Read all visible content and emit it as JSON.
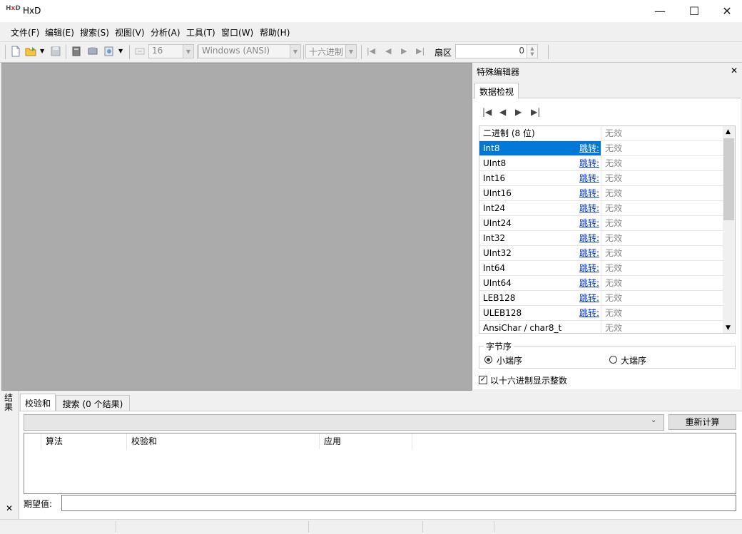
{
  "window": {
    "title": "HxD",
    "icon_text": "HxD"
  },
  "menu": [
    "文件(F)",
    "编辑(E)",
    "搜索(S)",
    "视图(V)",
    "分析(A)",
    "工具(T)",
    "窗口(W)",
    "帮助(H)"
  ],
  "toolbar": {
    "bytes_per_row": "16",
    "encoding": "Windows (ANSI)",
    "offset_base": "十六进制",
    "sector_label": "扇区",
    "sector_value": "0"
  },
  "special_editor": {
    "title": "特殊编辑器",
    "tab": "数据检视",
    "rows": [
      {
        "name": "二进制 (8 位)",
        "jump": "",
        "value": "无效"
      },
      {
        "name": "Int8",
        "jump": "跳转:",
        "value": "无效",
        "selected": true
      },
      {
        "name": "UInt8",
        "jump": "跳转:",
        "value": "无效"
      },
      {
        "name": "Int16",
        "jump": "跳转:",
        "value": "无效"
      },
      {
        "name": "UInt16",
        "jump": "跳转:",
        "value": "无效"
      },
      {
        "name": "Int24",
        "jump": "跳转:",
        "value": "无效"
      },
      {
        "name": "UInt24",
        "jump": "跳转:",
        "value": "无效"
      },
      {
        "name": "Int32",
        "jump": "跳转:",
        "value": "无效"
      },
      {
        "name": "UInt32",
        "jump": "跳转:",
        "value": "无效"
      },
      {
        "name": "Int64",
        "jump": "跳转:",
        "value": "无效"
      },
      {
        "name": "UInt64",
        "jump": "跳转:",
        "value": "无效"
      },
      {
        "name": "LEB128",
        "jump": "跳转:",
        "value": "无效"
      },
      {
        "name": "ULEB128",
        "jump": "跳转:",
        "value": "无效"
      },
      {
        "name": "AnsiChar / char8_t",
        "jump": "",
        "value": "无效"
      }
    ],
    "byte_order_label": "字节序",
    "little_endian": "小端序",
    "big_endian": "大端序",
    "hex_display_label": "以十六进制显示整数"
  },
  "results": {
    "title": "结果",
    "tabs": [
      "校验和",
      "搜索 (0 个结果)"
    ],
    "recalc": "重新计算",
    "columns": [
      "算法",
      "校验和",
      "应用"
    ],
    "expected_label": "期望值:"
  }
}
